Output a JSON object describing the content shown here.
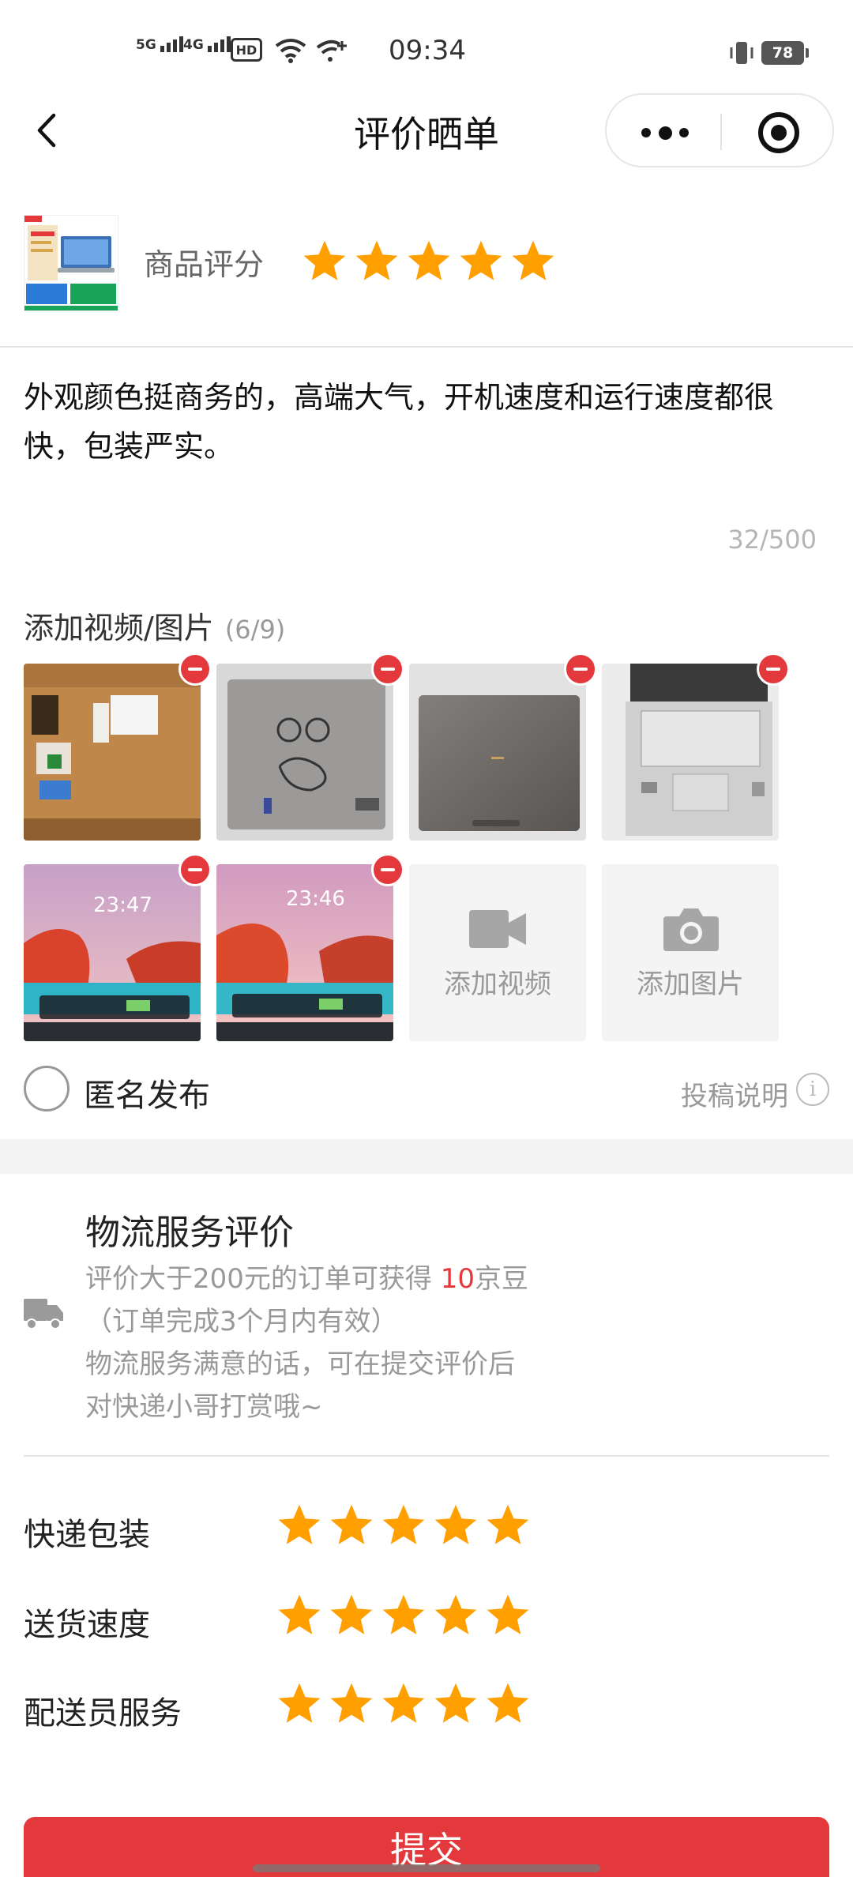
{
  "status_bar": {
    "sim1": "5G",
    "sim2": "4G",
    "hd_label": "HD",
    "time": "09:34",
    "battery": "78"
  },
  "nav": {
    "title": "评价晒单",
    "icons": {
      "back": "chevron-left-icon",
      "more": "more-icon",
      "target": "target-icon"
    }
  },
  "product": {
    "rating_label": "商品评分",
    "rating": 5,
    "rating_max": 5
  },
  "review": {
    "text": "外观颜色挺商务的，高端大气，开机速度和运行速度都很快，包装严实。",
    "char_count": "32/500"
  },
  "media": {
    "title": "添加视频/图片",
    "count": "(6/9)",
    "photos": [
      {
        "scene": "boxed"
      },
      {
        "scene": "gray-bag"
      },
      {
        "scene": "lid"
      },
      {
        "scene": "laptop-open"
      },
      {
        "scene": "screen",
        "time_text": "23:47"
      },
      {
        "scene": "screen",
        "time_text": "23:46"
      }
    ],
    "add_video_label": "添加视频",
    "add_photo_label": "添加图片"
  },
  "anonymous": {
    "label": "匿名发布",
    "checked": false,
    "guide_label": "投稿说明",
    "info_glyph": "i"
  },
  "logistics": {
    "title": "物流服务评价",
    "desc_line1_prefix": "评价大于200元的订单可获得 ",
    "desc_highlight": "10",
    "desc_line1_suffix": "京豆",
    "desc_line2": "（订单完成3个月内有效）",
    "desc_line3": "物流服务满意的话，可在提交评价后",
    "desc_line4": "对快递小哥打赏哦~",
    "ratings": [
      {
        "label": "快递包装",
        "value": 5
      },
      {
        "label": "送货速度",
        "value": 5
      },
      {
        "label": "配送员服务",
        "value": 5
      }
    ]
  },
  "submit_label": "提交",
  "colors": {
    "accent": "#e4393c",
    "star": "#ff9f00"
  }
}
